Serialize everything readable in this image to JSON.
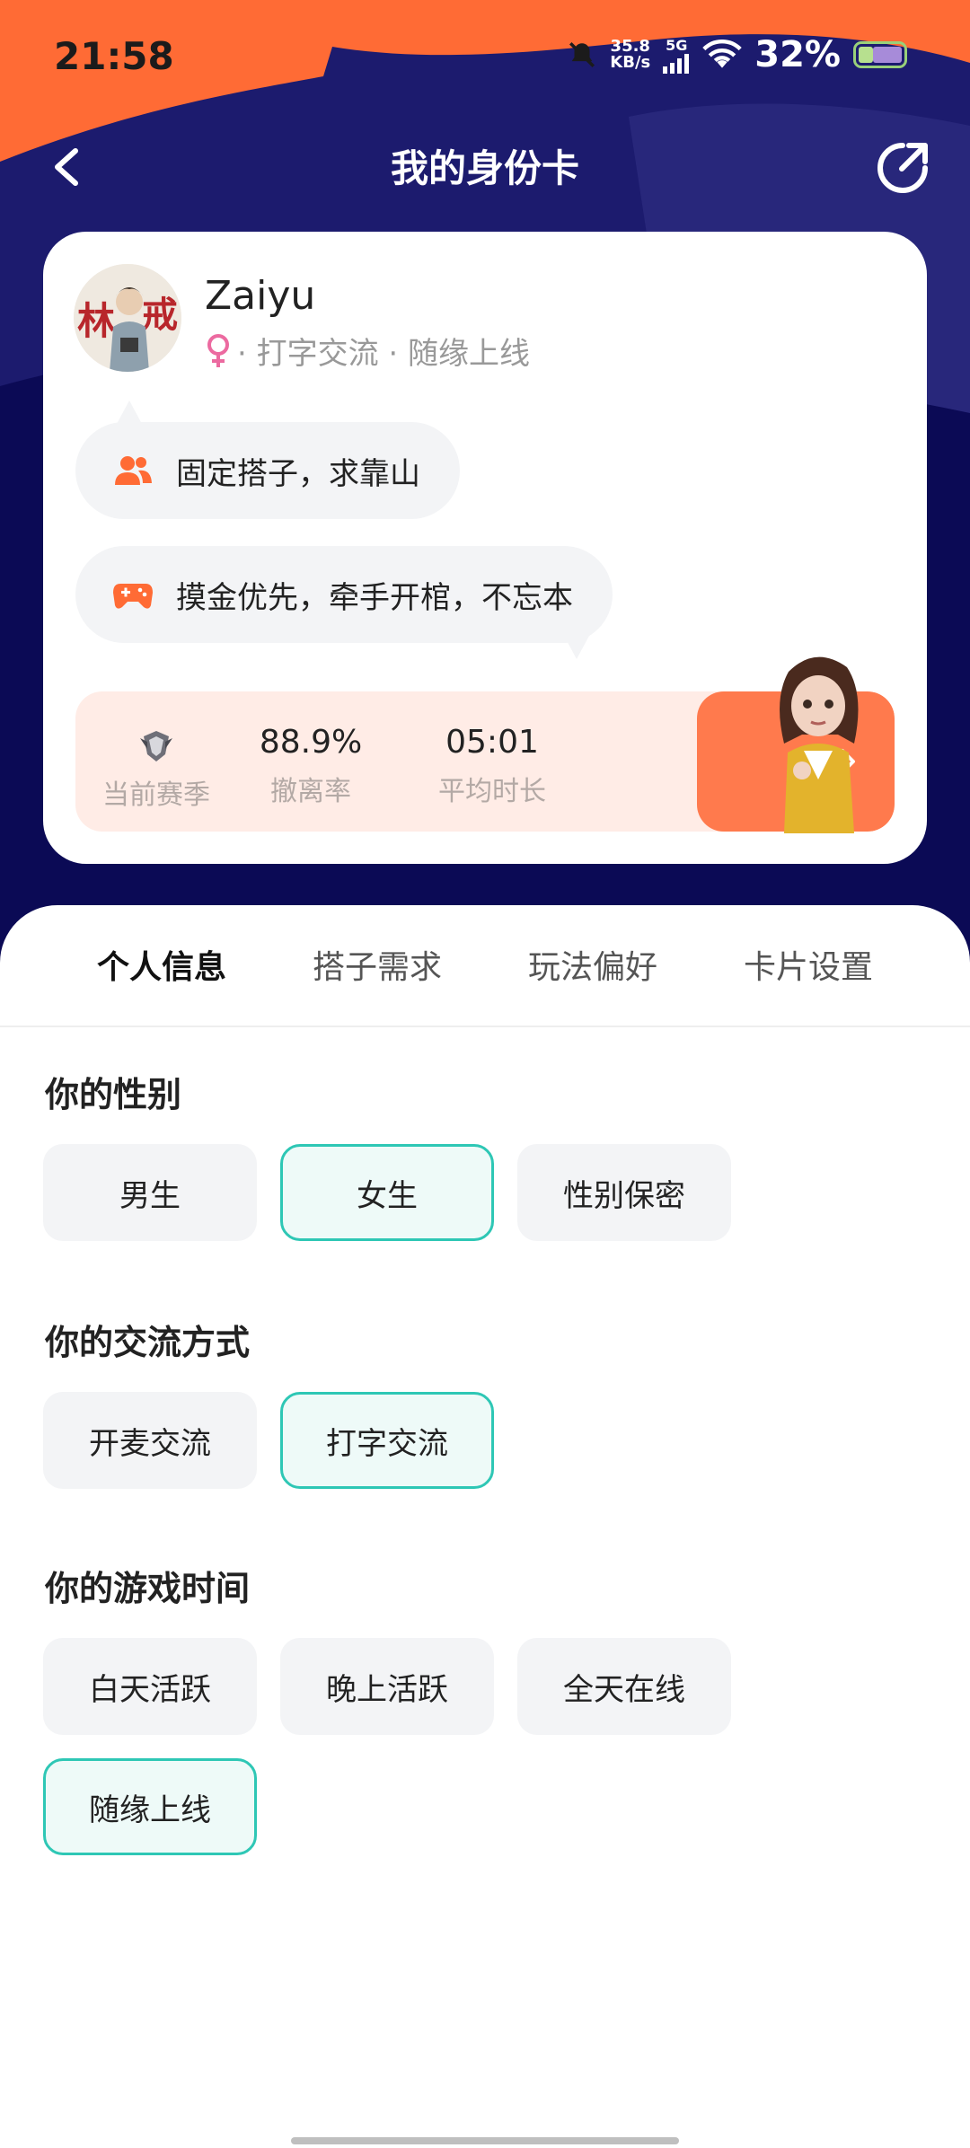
{
  "status_bar": {
    "time": "21:58",
    "net_speed_value": "35.8",
    "net_speed_unit": "KB/s",
    "network": "5G",
    "battery": "32%"
  },
  "nav": {
    "title": "我的身份卡",
    "back_icon": "back-arrow-icon",
    "share_icon": "share-icon"
  },
  "profile": {
    "username": "Zaiyu",
    "gender_icon": "female-icon",
    "tags": "· 打字交流 · 随缘上线",
    "bubbles": [
      {
        "icon": "users-icon",
        "text": "固定搭子，求靠山"
      },
      {
        "icon": "gamepad-icon",
        "text": "摸金优先，牵手开棺，不忘本"
      }
    ],
    "stats": [
      {
        "label": "当前赛季",
        "value": "",
        "icon": "rank-badge-icon"
      },
      {
        "label": "撤离率",
        "value": "88.9%"
      },
      {
        "label": "平均时长",
        "value": "05:01"
      }
    ]
  },
  "tabs": [
    "个人信息",
    "搭子需求",
    "玩法偏好",
    "卡片设置"
  ],
  "active_tab": "个人信息",
  "sections": {
    "gender": {
      "title": "你的性别",
      "options": [
        "男生",
        "女生",
        "性别保密"
      ],
      "selected": "女生"
    },
    "communication": {
      "title": "你的交流方式",
      "options": [
        "开麦交流",
        "打字交流"
      ],
      "selected": "打字交流"
    },
    "game_time": {
      "title": "你的游戏时间",
      "options": [
        "白天活跃",
        "晚上活跃",
        "全天在线",
        "随缘上线"
      ],
      "selected": "随缘上线"
    }
  },
  "colors": {
    "accent_orange": "#ff6b35",
    "header_navy": "#1c1b6e",
    "selected_teal": "#2ec7b5",
    "female_pink": "#ec6aa0"
  }
}
